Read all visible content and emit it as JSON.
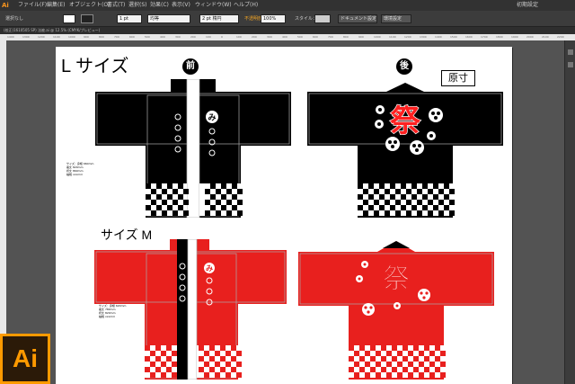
{
  "app": {
    "logo": "Ai",
    "menus": [
      "ファイル(F)",
      "編集(E)",
      "オブジェクト(O)",
      "書式(T)",
      "選択(S)",
      "効果(C)",
      "表示(V)",
      "ウィンドウ(W)",
      "ヘルプ(H)"
    ],
    "workspace": "初期設定"
  },
  "control": {
    "selection": "選択なし",
    "stroke_weight": "1 pt",
    "stroke_style": "均等",
    "brush": "2 pt 楕円",
    "opacity_label": "不透明度：",
    "opacity": "100%",
    "style_label": "スタイル：",
    "doc_setup": "ドキュメント設定",
    "prefs": "環境設定"
  },
  "tab": {
    "title": "(校正)1610505 SP) 法被.ai @ 12.5% (CMYK/プレビュー)"
  },
  "ruler": {
    "ticks": [
      "1400",
      "1300",
      "1200",
      "1100",
      "1000",
      "900",
      "800",
      "700",
      "600",
      "500",
      "400",
      "300",
      "200",
      "100",
      "0",
      "100",
      "200",
      "300",
      "400",
      "500",
      "600",
      "700",
      "800",
      "900",
      "1000",
      "1100",
      "1200",
      "1300",
      "1400",
      "1500",
      "1600",
      "1700",
      "1800",
      "1900",
      "2000",
      "2100",
      "2200"
    ]
  },
  "doc": {
    "size_l": "L サイズ",
    "size_m": "サイズ M",
    "front": "前",
    "back": "後",
    "actual": "原寸",
    "spec_l": [
      "サイズ：身幅 660mm",
      "着丈 820mm",
      "裄丈 860mm",
      "袖幅 xxxmm"
    ],
    "spec_m": [
      "サイズ：身幅 620mm",
      "着丈 780mm",
      "裄丈 820mm",
      "袖幅 xxxmm"
    ],
    "matsuri": "祭",
    "mi": "み"
  },
  "colors": {
    "black": "#000000",
    "red": "#e8201e",
    "white": "#ffffff",
    "accent": "#f7941d"
  },
  "icons": [
    "scroll-arrows-icon",
    "panel-strip-icon"
  ],
  "corner": {
    "logo": "Ai"
  }
}
